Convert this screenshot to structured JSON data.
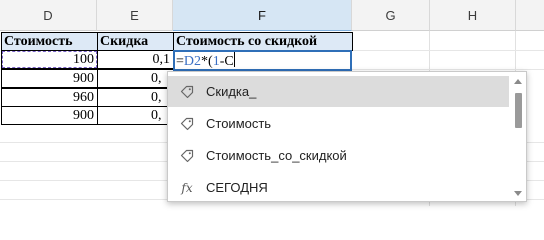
{
  "columns": [
    "D",
    "E",
    "F",
    "G",
    "H"
  ],
  "headers": {
    "d": "Стоимость",
    "e": "Скидка",
    "f": "Стоимость со скидкой"
  },
  "rows": [
    {
      "d": "100",
      "e": "0,1"
    },
    {
      "d": "900",
      "e": "0,"
    },
    {
      "d": "960",
      "e": "0,"
    },
    {
      "d": "900",
      "e": "0,"
    }
  ],
  "formula": {
    "eq": "=",
    "ref": "D2",
    "op": "*(",
    "one": "1",
    "rest": "-С"
  },
  "autocomplete": {
    "items": [
      {
        "label": "Скидка_",
        "icon": "tag-icon"
      },
      {
        "label": "Стоимость",
        "icon": "tag-icon"
      },
      {
        "label": "Стоимость_со_скидкой",
        "icon": "tag-icon"
      },
      {
        "label": "СЕГОДНЯ",
        "icon": "function-icon",
        "glyph": "fx"
      }
    ]
  }
}
